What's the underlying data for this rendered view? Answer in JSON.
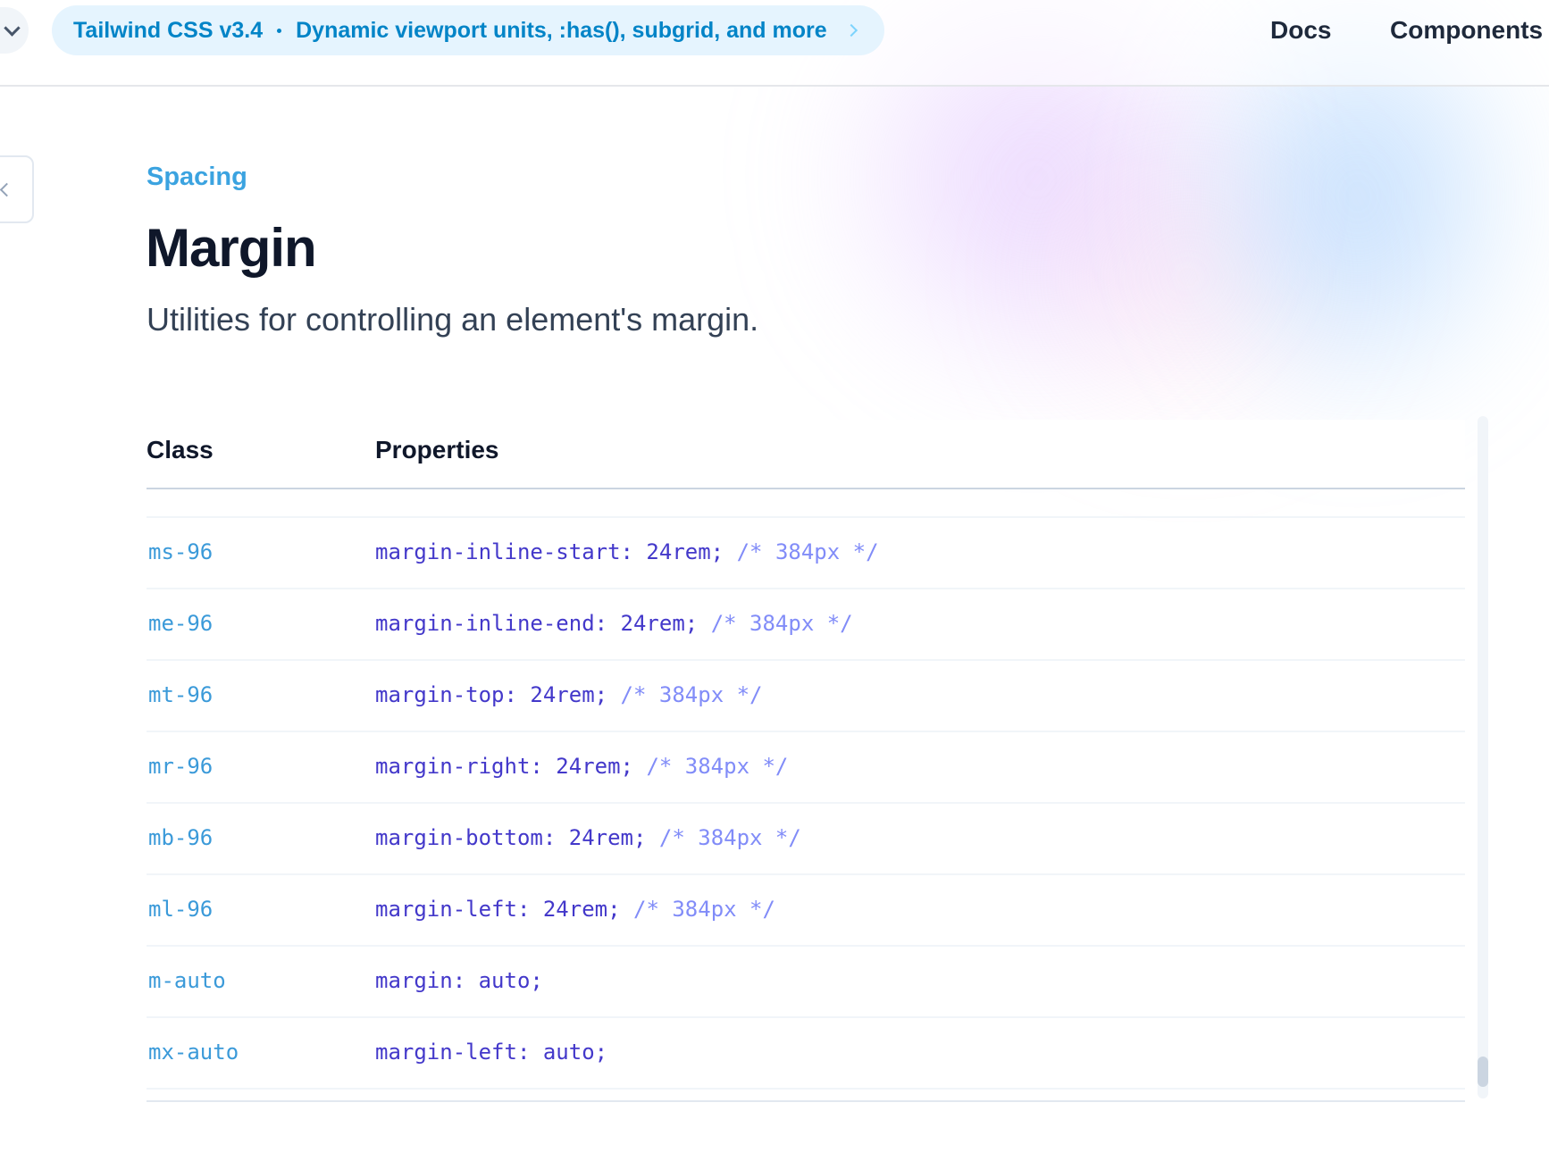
{
  "header": {
    "announcement": {
      "version": "Tailwind CSS v3.4",
      "message": "Dynamic viewport units, :has(), subgrid, and more"
    },
    "nav": {
      "docs": "Docs",
      "components": "Components"
    }
  },
  "page": {
    "eyebrow": "Spacing",
    "title": "Margin",
    "lead": "Utilities for controlling an element's margin."
  },
  "table": {
    "headers": {
      "class": "Class",
      "properties": "Properties"
    },
    "rows": [
      {
        "class": "ms-96",
        "property": "margin-inline-start: 24rem;",
        "comment": "/* 384px */"
      },
      {
        "class": "me-96",
        "property": "margin-inline-end: 24rem;",
        "comment": "/* 384px */"
      },
      {
        "class": "mt-96",
        "property": "margin-top: 24rem;",
        "comment": "/* 384px */"
      },
      {
        "class": "mr-96",
        "property": "margin-right: 24rem;",
        "comment": "/* 384px */"
      },
      {
        "class": "mb-96",
        "property": "margin-bottom: 24rem;",
        "comment": "/* 384px */"
      },
      {
        "class": "ml-96",
        "property": "margin-left: 24rem;",
        "comment": "/* 384px */"
      },
      {
        "class": "m-auto",
        "property": "margin: auto;",
        "comment": ""
      },
      {
        "class": "mx-auto",
        "property": "margin-left: auto;",
        "comment": ""
      }
    ]
  },
  "icons": {
    "version_toggle": "chevron-down-icon",
    "announcement_arrow": "chevron-right-icon",
    "sidebar_toggle": "chevron-left-icon"
  },
  "colors": {
    "accent": "#3b9ad9",
    "property_text": "#4338ca",
    "comment_text": "#818cf8",
    "title": "#0f172a"
  }
}
